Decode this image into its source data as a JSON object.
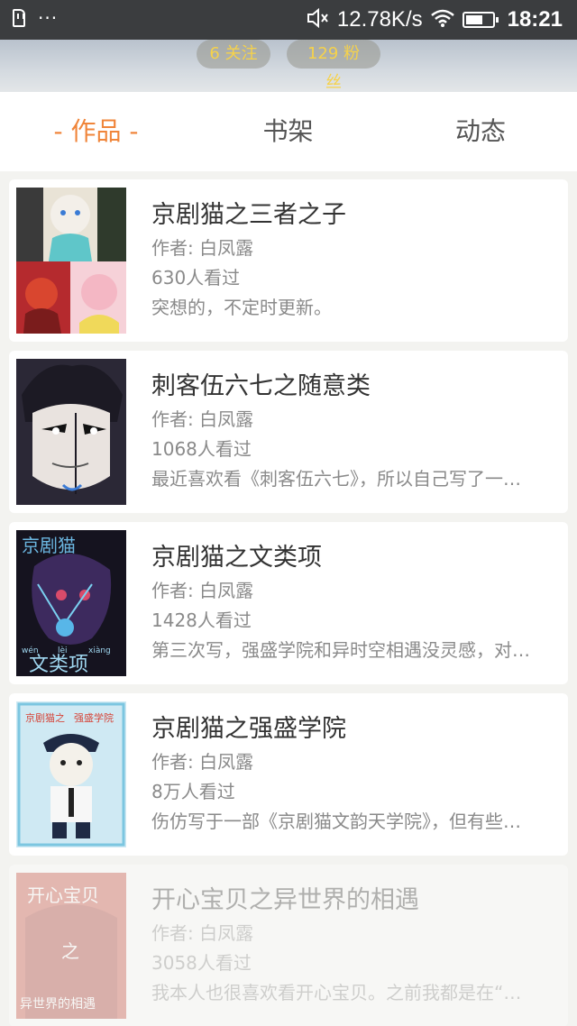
{
  "status_bar": {
    "more_glyph": "···",
    "speed": "12.78K/s",
    "time": "18:21",
    "icons": [
      "sd-card-icon",
      "mute-icon",
      "wifi-icon",
      "battery-icon"
    ]
  },
  "profile": {
    "follow_label": "6 关注",
    "fans_label": "129 粉丝"
  },
  "tabs": [
    {
      "label": "- 作品 -",
      "active": true
    },
    {
      "label": "书架",
      "active": false
    },
    {
      "label": "动态",
      "active": false
    }
  ],
  "works": [
    {
      "title": "京剧猫之三者之子",
      "author": "作者: 白凤露",
      "views": "630人看过",
      "desc": "突想的，不定时更新。"
    },
    {
      "title": "刺客伍六七之随意类",
      "author": "作者: 白凤露",
      "views": "1068人看过",
      "desc": "最近喜欢看《刺客伍六七》，所以自己写了一…"
    },
    {
      "title": "京剧猫之文类项",
      "author": "作者: 白凤露",
      "views": "1428人看过",
      "desc": "第三次写，强盛学院和异时空相遇没灵感，对…",
      "cover_text": [
        "京剧猫",
        "wén",
        "lèi",
        "xiàng",
        "文类项"
      ]
    },
    {
      "title": "京剧猫之强盛学院",
      "author": "作者: 白凤露",
      "views": "8万人看过",
      "desc": "伤仿写于一部《京剧猫文韵天学院》，但有些…",
      "cover_text": [
        "京剧猫之",
        "强盛学院"
      ]
    },
    {
      "title": "开心宝贝之异世界的相遇",
      "author": "作者: 白凤露",
      "views": "3058人看过",
      "desc": "我本人也很喜欢看开心宝贝。之前我都是在“…",
      "cover_text": [
        "开心宝贝",
        "之",
        "异世界的相遇"
      ]
    }
  ]
}
